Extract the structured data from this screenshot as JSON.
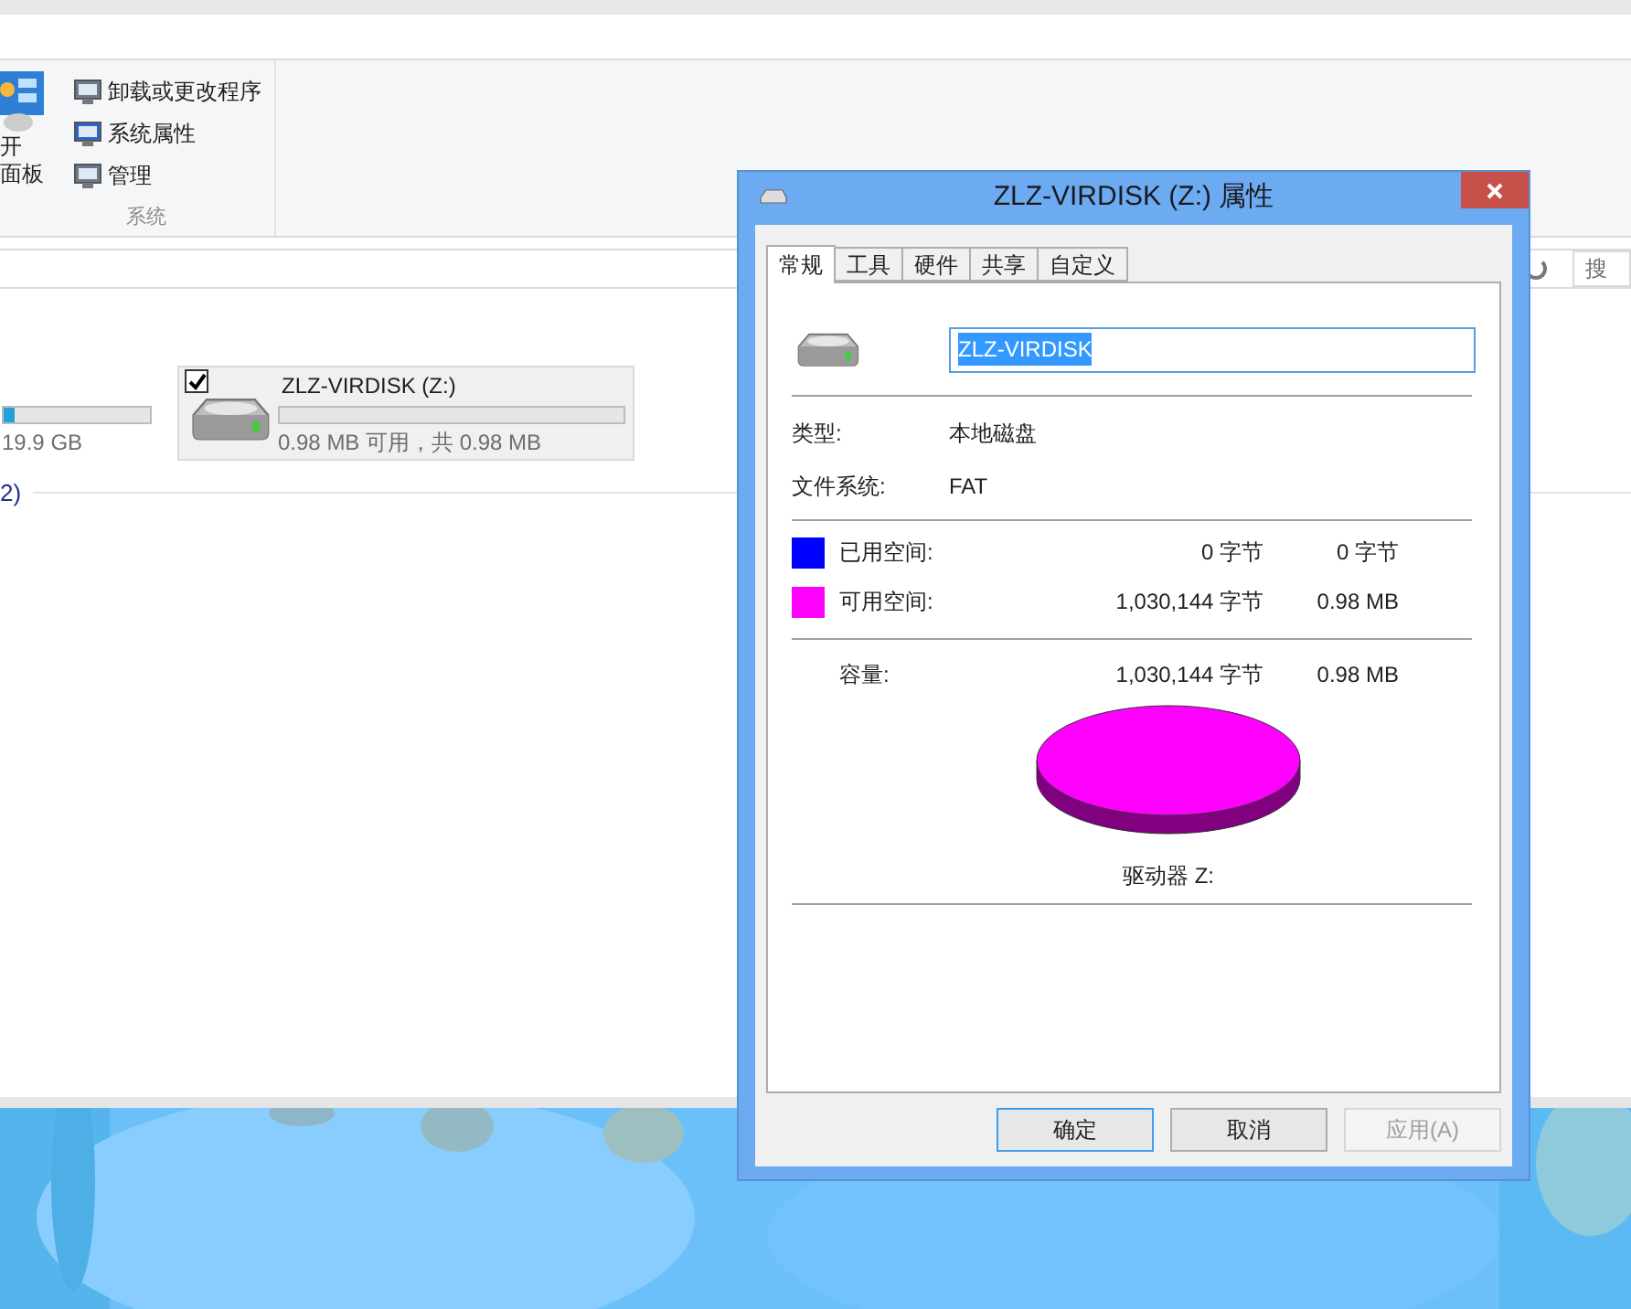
{
  "ribbon": {
    "large_button": {
      "label_lines": [
        "开",
        "面板"
      ]
    },
    "items": [
      {
        "label": "卸载或更改程序"
      },
      {
        "label": "系统属性"
      },
      {
        "label": "管理"
      }
    ],
    "group_label": "系统"
  },
  "search": {
    "placeholder": "搜"
  },
  "group_header": "2)",
  "drives": [
    {
      "kind": "partial",
      "selected": false,
      "level": 0.08,
      "info": "19.9 GB"
    },
    {
      "kind": "full",
      "selected": true,
      "checked": true,
      "name": "ZLZ-VIRDISK (Z:)",
      "level": 0,
      "info": "0.98 MB 可用，共 0.98 MB"
    }
  ],
  "dialog": {
    "title": "ZLZ-VIRDISK (Z:) 属性",
    "tabs": [
      {
        "label": "常规",
        "selected": true
      },
      {
        "label": "工具",
        "selected": false
      },
      {
        "label": "硬件",
        "selected": false
      },
      {
        "label": "共享",
        "selected": false
      },
      {
        "label": "自定义",
        "selected": false
      }
    ],
    "name_value": "ZLZ-VIRDISK",
    "info": [
      {
        "label": "类型:",
        "value": "本地磁盘"
      },
      {
        "label": "文件系统:",
        "value": "FAT"
      }
    ],
    "space": [
      {
        "label": "已用空间:",
        "color": "#0000ff",
        "bytes": "0 字节",
        "size": "0 字节"
      },
      {
        "label": "可用空间:",
        "color": "#ff00ff",
        "bytes": "1,030,144 字节",
        "size": "0.98 MB"
      }
    ],
    "capacity": {
      "label": "容量:",
      "bytes": "1,030,144 字节",
      "size": "0.98 MB"
    },
    "drive_label": "驱动器 Z:",
    "buttons": [
      {
        "label": "确定",
        "default": true,
        "disabled": false
      },
      {
        "label": "取消",
        "default": false,
        "disabled": false
      },
      {
        "label": "应用(A)",
        "default": false,
        "disabled": true
      }
    ]
  }
}
